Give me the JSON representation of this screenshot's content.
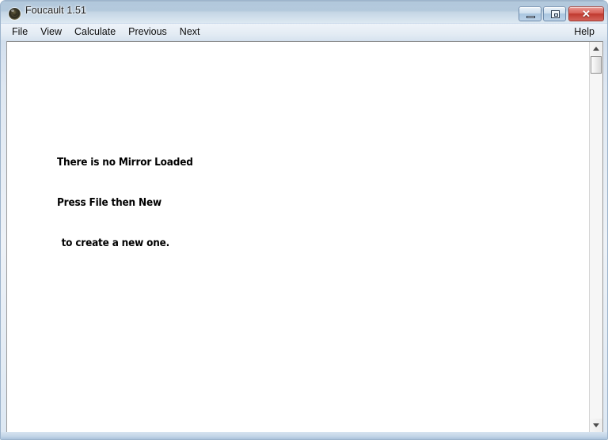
{
  "window": {
    "title": "Foucault 1.51",
    "icon": "mirror-lens-icon",
    "frame_color": "#b9cfe4",
    "titlebar_gradient_top": "#5f7d9c",
    "titlebar_gradient_bottom": "#dde8f1"
  },
  "window_buttons": {
    "minimize_label": "Minimize",
    "maximize_label": "Maximize",
    "close_label": "Close",
    "close_glyph": "✕",
    "close_color": "#c0392f"
  },
  "menu": {
    "items": [
      {
        "label": "File",
        "name": "menu-item-file"
      },
      {
        "label": "View",
        "name": "menu-item-view"
      },
      {
        "label": "Calculate",
        "name": "menu-item-calculate"
      },
      {
        "label": "Previous",
        "name": "menu-item-previous"
      },
      {
        "label": "Next",
        "name": "menu-item-next"
      }
    ],
    "help": {
      "label": "Help",
      "name": "menu-item-help"
    }
  },
  "canvas": {
    "background": "#ffffff",
    "message": {
      "line1": "There is no Mirror Loaded",
      "line2": "Press File then New",
      "line3": "to create a new one."
    }
  },
  "scrollbar": {
    "orientation": "vertical",
    "up_arrow": "scroll-up-arrow",
    "down_arrow": "scroll-down-arrow",
    "thumb": "scroll-thumb",
    "position_percent": 0
  }
}
